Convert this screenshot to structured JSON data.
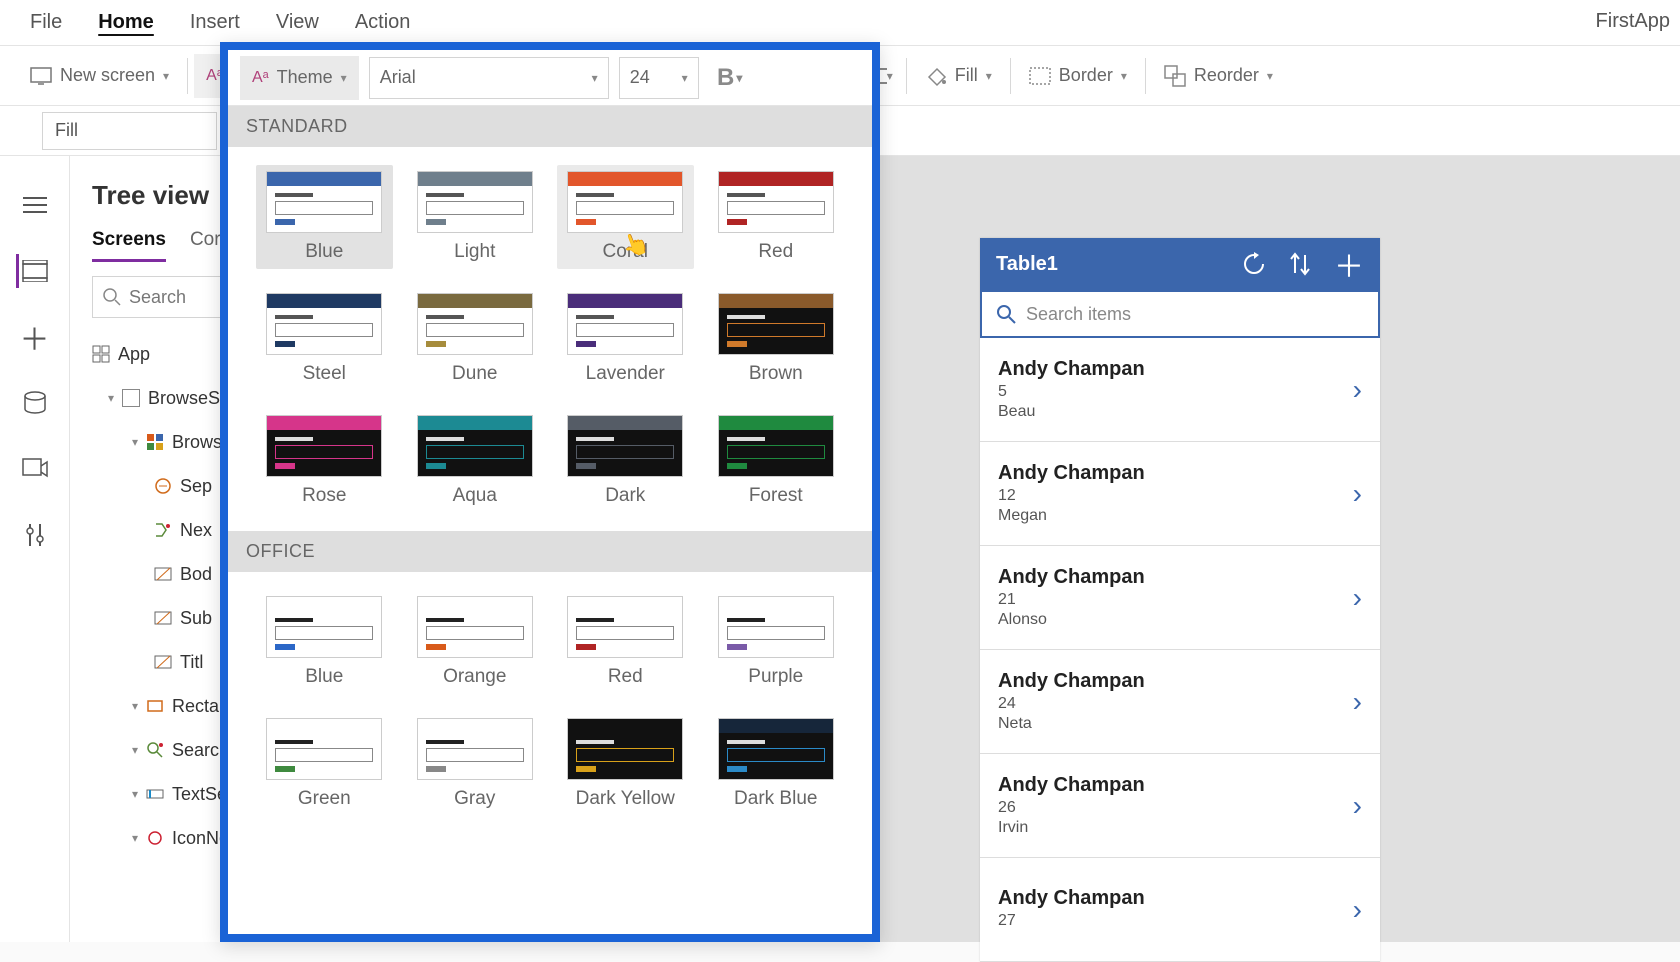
{
  "app_name_partial": "FirstApp",
  "menubar": {
    "items": [
      "File",
      "Home",
      "Insert",
      "View",
      "Action"
    ],
    "active": "Home"
  },
  "ribbon": {
    "new_screen": "New screen",
    "theme": "Theme",
    "font": "Arial",
    "font_size": "24",
    "fill": "Fill",
    "border": "Border",
    "reorder": "Reorder"
  },
  "formula": {
    "property": "Fill"
  },
  "tree": {
    "title": "Tree view",
    "tabs": [
      "Screens",
      "Cor"
    ],
    "active_tab": "Screens",
    "search_placeholder": "Search",
    "app_label": "App",
    "items": [
      {
        "label": "BrowseSc",
        "level": 1,
        "icon": "screen"
      },
      {
        "label": "Browse",
        "level": 2,
        "icon": "gallery"
      },
      {
        "label": "Sep",
        "level": 3,
        "icon": "sep"
      },
      {
        "label": "Nex",
        "level": 3,
        "icon": "next"
      },
      {
        "label": "Bod",
        "level": 3,
        "icon": "label"
      },
      {
        "label": "Sub",
        "level": 3,
        "icon": "label"
      },
      {
        "label": "Titl",
        "level": 3,
        "icon": "label"
      },
      {
        "label": "Rectang",
        "level": 2,
        "icon": "rect"
      },
      {
        "label": "SearchI",
        "level": 2,
        "icon": "searchicon"
      },
      {
        "label": "TextSe",
        "level": 2,
        "icon": "textinput"
      },
      {
        "label": "IconNe",
        "level": 2,
        "icon": "icon"
      }
    ]
  },
  "theme_dropdown": {
    "section_standard": "STANDARD",
    "section_office": "OFFICE",
    "selected": "Blue",
    "hovered": "Coral",
    "standard": [
      {
        "name": "Blue",
        "top": "#3b66ac",
        "accent": "#3b66ac",
        "body": "light"
      },
      {
        "name": "Light",
        "top": "#6f7f8c",
        "accent": "#6f7f8c",
        "body": "light"
      },
      {
        "name": "Coral",
        "top": "#e2562b",
        "accent": "#e2562b",
        "body": "light"
      },
      {
        "name": "Red",
        "top": "#b02424",
        "accent": "#b02424",
        "body": "light"
      },
      {
        "name": "Steel",
        "top": "#1f3a63",
        "accent": "#1f3a63",
        "body": "light"
      },
      {
        "name": "Dune",
        "top": "#7a6a3f",
        "accent": "#a68c3c",
        "body": "light"
      },
      {
        "name": "Lavender",
        "top": "#4a2d7a",
        "accent": "#4a2d7a",
        "body": "light"
      },
      {
        "name": "Brown",
        "top": "#8a5a2b",
        "accent": "#d07a2b",
        "body": "dark"
      },
      {
        "name": "Rose",
        "top": "#d6358a",
        "accent": "#d6358a",
        "body": "dark"
      },
      {
        "name": "Aqua",
        "top": "#1c8a93",
        "accent": "#1c8a93",
        "body": "dark"
      },
      {
        "name": "Dark",
        "top": "#555c66",
        "accent": "#555c66",
        "body": "dark"
      },
      {
        "name": "Forest",
        "top": "#1f8a3f",
        "accent": "#1f8a3f",
        "body": "dark"
      }
    ],
    "office": [
      {
        "name": "Blue",
        "top": "#ffffff",
        "accent": "#2b67c7",
        "body": "light",
        "line": "#222"
      },
      {
        "name": "Orange",
        "top": "#ffffff",
        "accent": "#d85a1a",
        "body": "light",
        "line": "#222"
      },
      {
        "name": "Red",
        "top": "#ffffff",
        "accent": "#b02424",
        "body": "light",
        "line": "#222"
      },
      {
        "name": "Purple",
        "top": "#ffffff",
        "accent": "#7a5aa8",
        "body": "light",
        "line": "#222"
      },
      {
        "name": "Green",
        "top": "#ffffff",
        "accent": "#3f8a3f",
        "body": "light",
        "line": "#222"
      },
      {
        "name": "Gray",
        "top": "#ffffff",
        "accent": "#888888",
        "body": "light",
        "line": "#222"
      },
      {
        "name": "Dark Yellow",
        "top": "#111111",
        "accent": "#d8a11a",
        "body": "dark",
        "line": "#ddd"
      },
      {
        "name": "Dark Blue",
        "top": "#16263a",
        "accent": "#2b8ac7",
        "body": "dark",
        "line": "#ddd"
      }
    ]
  },
  "phone": {
    "header_title": "Table1",
    "search_placeholder": "Search items",
    "items": [
      {
        "title": "Andy Champan",
        "num": "5",
        "sub": "Beau"
      },
      {
        "title": "Andy Champan",
        "num": "12",
        "sub": "Megan"
      },
      {
        "title": "Andy Champan",
        "num": "21",
        "sub": "Alonso"
      },
      {
        "title": "Andy Champan",
        "num": "24",
        "sub": "Neta"
      },
      {
        "title": "Andy Champan",
        "num": "26",
        "sub": "Irvin"
      },
      {
        "title": "Andy Champan",
        "num": "27",
        "sub": ""
      }
    ]
  }
}
